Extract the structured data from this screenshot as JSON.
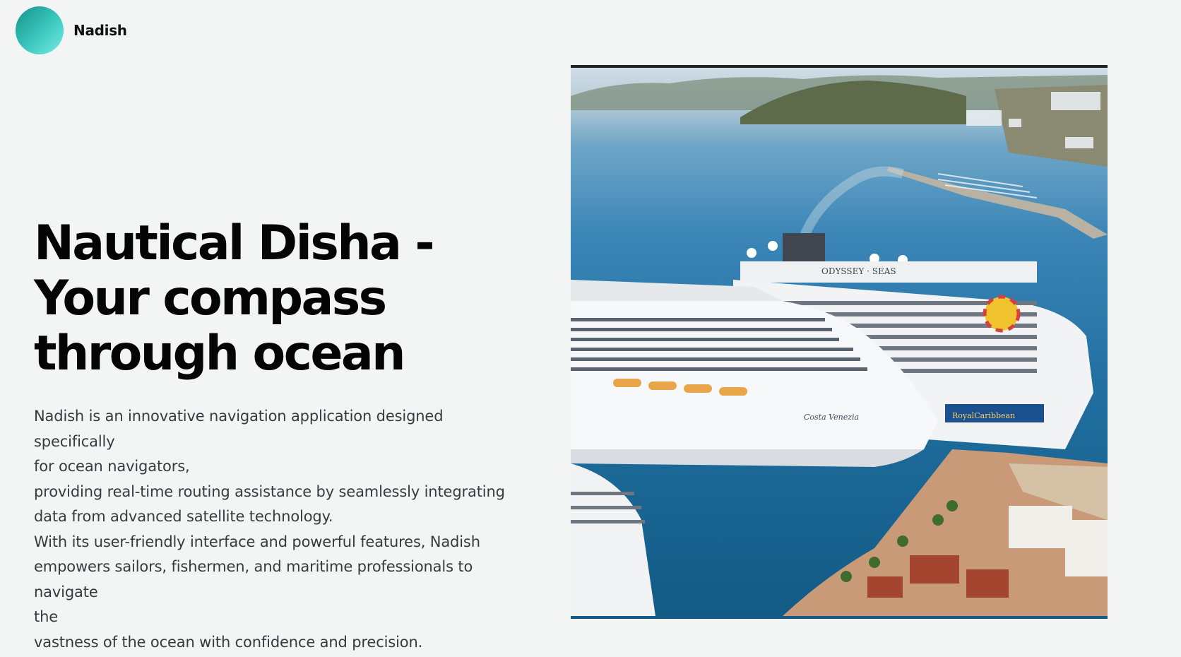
{
  "header": {
    "brand_name": "Nadish",
    "logo_icon": "gradient-circle-logo",
    "logo_colors": [
      "#16928a",
      "#79ece4"
    ]
  },
  "hero": {
    "title_lines": [
      "Nautical Disha -",
      "Your compass",
      "through ocean"
    ],
    "description_lines": [
      "Nadish is an innovative navigation application designed specifically",
      "for ocean navigators,",
      "providing real-time routing assistance by seamlessly integrating",
      "data from advanced satellite technology.",
      "With its user-friendly interface and powerful features, Nadish",
      "empowers sailors, fishermen, and maritime professionals to navigate",
      "the",
      "vastness of the ocean with confidence and precision."
    ]
  },
  "image": {
    "ship_name_1": "ODYSSEY · SEAS",
    "ship_name_2": "Costa Venezia",
    "ship_name_3": "RoyalCaribbean"
  }
}
